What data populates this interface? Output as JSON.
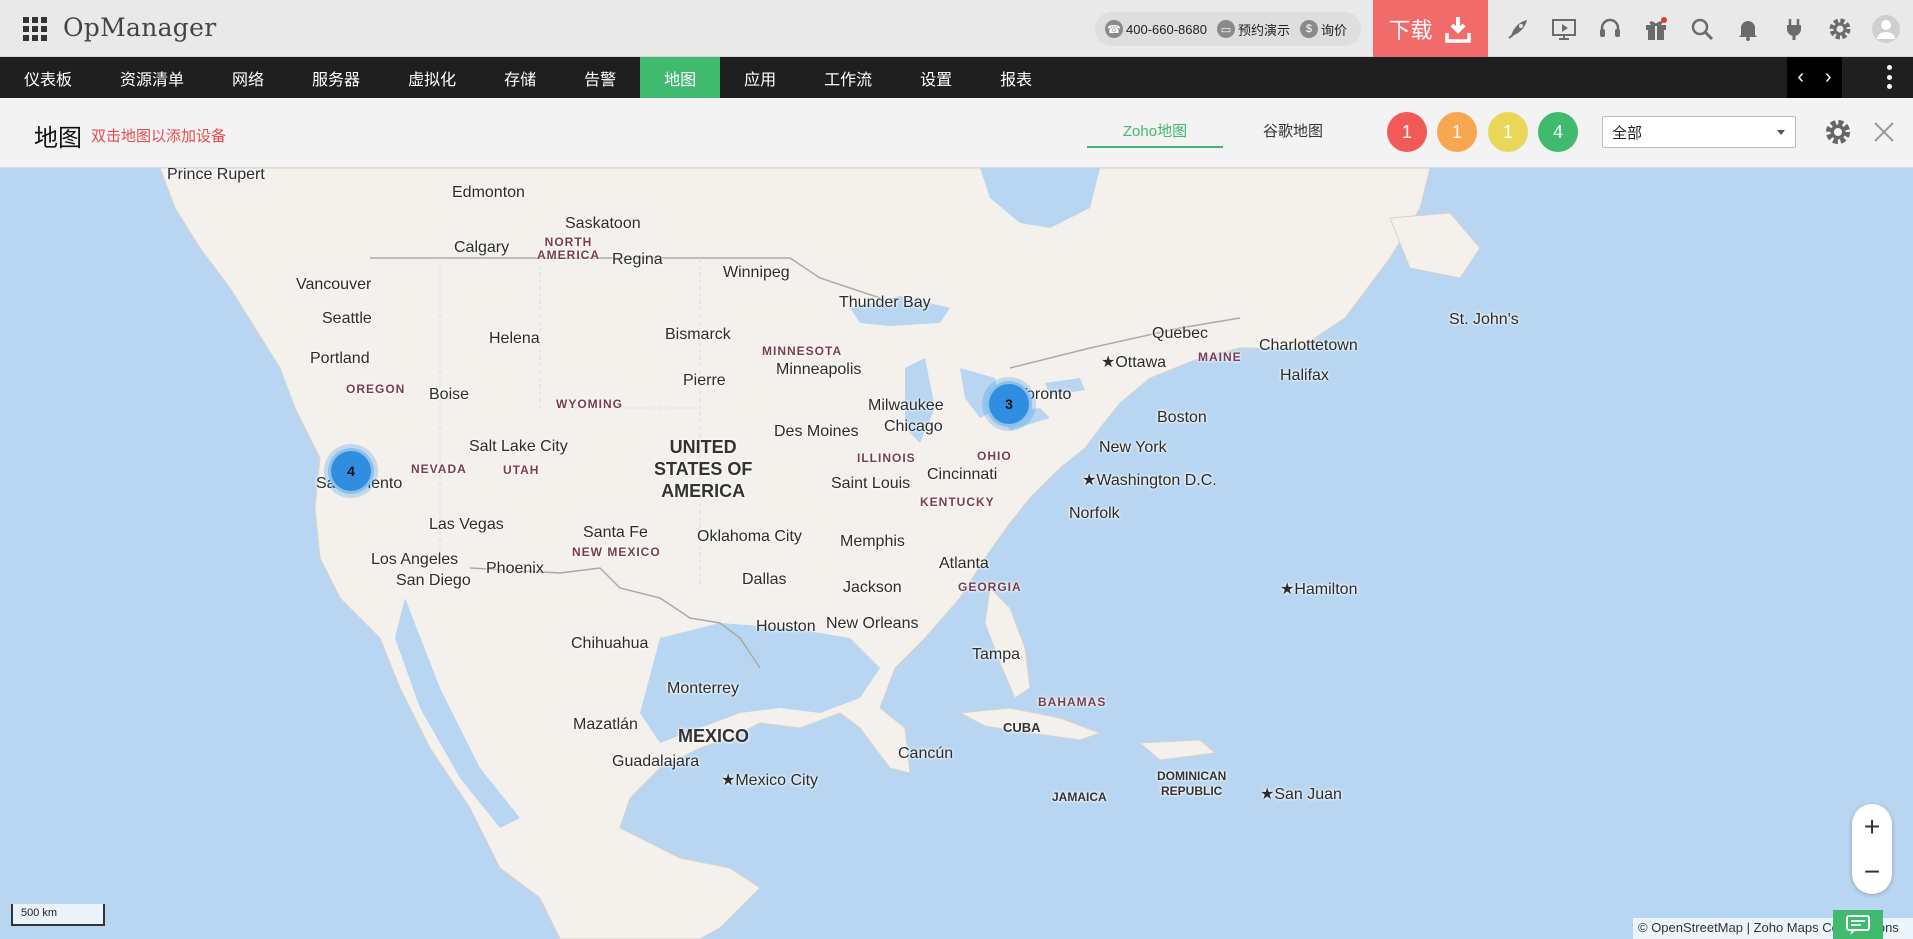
{
  "app": {
    "title": "OpManager"
  },
  "contact": {
    "phone": "400-660-8680",
    "demo": "预约演示",
    "quote": "询价"
  },
  "download": {
    "label": "下载"
  },
  "top_icons": [
    "rocket-icon",
    "presentation-icon",
    "headset-icon",
    "gift-icon",
    "search-icon",
    "bell-icon",
    "plug-icon",
    "gear-icon",
    "user-avatar-icon"
  ],
  "nav": {
    "items": [
      {
        "label": "仪表板"
      },
      {
        "label": "资源清单"
      },
      {
        "label": "网络"
      },
      {
        "label": "服务器"
      },
      {
        "label": "虚拟化"
      },
      {
        "label": "存储"
      },
      {
        "label": "告警"
      },
      {
        "label": "地图"
      },
      {
        "label": "应用"
      },
      {
        "label": "工作流"
      },
      {
        "label": "设置"
      },
      {
        "label": "报表"
      }
    ],
    "active_index": 7
  },
  "page": {
    "title": "地图",
    "hint": "双击地图以添加设备",
    "tabs": [
      {
        "label": "Zoho地图"
      },
      {
        "label": "谷歌地图"
      }
    ],
    "severity_counts": [
      {
        "value": "1",
        "color": "#f25a5a"
      },
      {
        "value": "1",
        "color": "#f6a750"
      },
      {
        "value": "1",
        "color": "#e9d75a"
      },
      {
        "value": "4",
        "color": "#3fba6e"
      }
    ],
    "filter": {
      "selected": "全部"
    }
  },
  "map": {
    "clusters": [
      {
        "count": "3"
      },
      {
        "count": "4"
      }
    ],
    "scale": "500 km",
    "attribution": "© OpenStreetMap |  Zoho Maps  Contributions",
    "labels": {
      "prince_rupert": "Prince Rupert",
      "edmonton": "Edmonton",
      "saskatoon": "Saskatoon",
      "calgary": "Calgary",
      "north_america": "NORTH\nAMERICA",
      "regina": "Regina",
      "winnipeg": "Winnipeg",
      "vancouver": "Vancouver",
      "thunder_bay": "Thunder Bay",
      "seattle": "Seattle",
      "helena": "Helena",
      "bismarck": "Bismarck",
      "quebec": "Quebec",
      "st_johns": "St. John's",
      "minnesota": "MINNESOTA",
      "portland": "Portland",
      "ottawa": "★Ottawa",
      "maine": "MAINE",
      "charlottetown": "Charlottetown",
      "minneapolis": "Minneapolis",
      "halifax": "Halifax",
      "oregon": "OREGON",
      "pierre": "Pierre",
      "boise": "Boise",
      "toronto": "Toronto",
      "wyoming": "WYOMING",
      "milwaukee": "Milwaukee",
      "boston": "Boston",
      "chicago": "Chicago",
      "des_moines": "Des Moines",
      "salt_lake_city": "Salt Lake City",
      "usa": "UNITED\nSTATES OF\nAMERICA",
      "new_york": "New York",
      "nevada": "NEVADA",
      "utah": "UTAH",
      "illinois": "ILLINOIS",
      "ohio": "OHIO",
      "cincinnati": "Cincinnati",
      "washington": "★Washington D.C.",
      "sacramento": "Sacramento",
      "saint_louis": "Saint Louis",
      "kentucky": "KENTUCKY",
      "norfolk": "Norfolk",
      "las_vegas": "Las Vegas",
      "santa_fe": "Santa Fe",
      "oklahoma_city": "Oklahoma City",
      "new_mexico": "NEW MEXICO",
      "memphis": "Memphis",
      "los_angeles": "Los Angeles",
      "atlanta": "Atlanta",
      "phoenix": "Phoenix",
      "san_diego": "San Diego",
      "dallas": "Dallas",
      "jackson": "Jackson",
      "georgia": "GEORGIA",
      "hamilton": "★Hamilton",
      "houston": "Houston",
      "new_orleans": "New Orleans",
      "chihuahua": "Chihuahua",
      "tampa": "Tampa",
      "monterrey": "Monterrey",
      "bahamas": "BAHAMAS",
      "mazatlan": "Mazatlán",
      "cuba": "CUBA",
      "mexico": "MEXICO",
      "guadalajara": "Guadalajara",
      "cancun": "Cancún",
      "mexico_city": "★Mexico City",
      "dominican_republic": "DOMINICAN\nREPUBLIC",
      "san_juan": "★San Juan",
      "jamaica": "JAMAICA"
    }
  }
}
